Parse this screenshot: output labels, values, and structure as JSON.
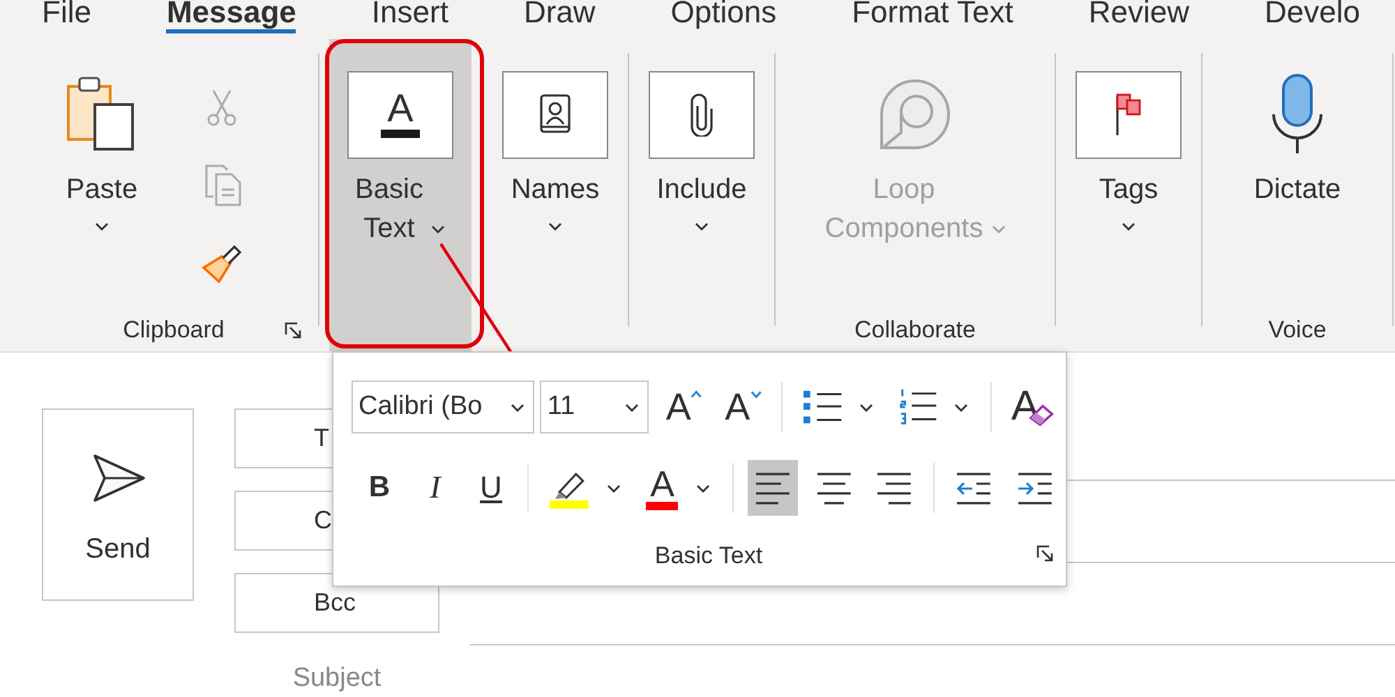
{
  "tabs": [
    {
      "label": "File",
      "selected": false
    },
    {
      "label": "Message",
      "selected": true
    },
    {
      "label": "Insert",
      "selected": false
    },
    {
      "label": "Draw",
      "selected": false
    },
    {
      "label": "Options",
      "selected": false
    },
    {
      "label": "Format Text",
      "selected": false
    },
    {
      "label": "Review",
      "selected": false
    },
    {
      "label": "Develo",
      "selected": false
    }
  ],
  "ribbon": {
    "groups": [
      {
        "label": "Clipboard",
        "launcher": true,
        "buttons": [
          {
            "kind": "paste",
            "label": "Paste",
            "dropdown": true,
            "disabled": false,
            "expanded": false
          }
        ],
        "small_buttons": [
          {
            "kind": "cut",
            "disabled": true
          },
          {
            "kind": "copy",
            "disabled": true
          },
          {
            "kind": "format_painter",
            "disabled": false
          }
        ]
      },
      {
        "buttons": [
          {
            "kind": "basic_text",
            "icon_text": "A",
            "label": "Basic Text",
            "dropdown": true,
            "disabled": false,
            "expanded": true
          }
        ]
      },
      {
        "buttons": [
          {
            "kind": "names",
            "label": "Names",
            "dropdown": true,
            "disabled": false,
            "expanded": false
          }
        ]
      },
      {
        "buttons": [
          {
            "kind": "include",
            "label": "Include",
            "dropdown": true,
            "disabled": false,
            "expanded": false
          }
        ]
      },
      {
        "label": "Collaborate",
        "buttons": [
          {
            "kind": "loop",
            "label": "Loop Components",
            "dropdown": true,
            "disabled": true,
            "expanded": false
          }
        ]
      },
      {
        "buttons": [
          {
            "kind": "tags",
            "label": "Tags",
            "dropdown": true,
            "disabled": false,
            "expanded": false
          }
        ]
      },
      {
        "label": "Voice",
        "buttons": [
          {
            "kind": "dictate",
            "label": "Dictate",
            "dropdown": false,
            "disabled": false,
            "expanded": false
          }
        ]
      }
    ]
  },
  "compose": {
    "send": "Send",
    "recipients": [
      "T",
      "C",
      "Bcc"
    ],
    "subject": "Subject"
  },
  "popup": {
    "title": "Basic Text",
    "launcher": true,
    "font": "Calibri (Bo",
    "size": "11",
    "rows": [
      [
        {
          "kind": "grow_font",
          "label": "A"
        },
        {
          "kind": "shrink_font",
          "label": "A"
        },
        {
          "kind": "separator"
        },
        {
          "kind": "bullets",
          "dropdown": true
        },
        {
          "kind": "numbering",
          "dropdown": true
        },
        {
          "kind": "separator"
        },
        {
          "kind": "clear_formatting",
          "label": "A"
        }
      ],
      [
        {
          "kind": "bold",
          "label": "B"
        },
        {
          "kind": "italic",
          "label": "I"
        },
        {
          "kind": "underline",
          "label": "U"
        },
        {
          "kind": "separator"
        },
        {
          "kind": "highlight",
          "dropdown": true
        },
        {
          "kind": "font_color",
          "label": "A",
          "dropdown": true
        },
        {
          "kind": "separator"
        },
        {
          "kind": "align_left",
          "selected": true
        },
        {
          "kind": "align_center",
          "selected": false
        },
        {
          "kind": "align_right",
          "selected": false
        },
        {
          "kind": "separator"
        },
        {
          "kind": "decrease_indent"
        },
        {
          "kind": "increase_indent"
        }
      ]
    ]
  }
}
